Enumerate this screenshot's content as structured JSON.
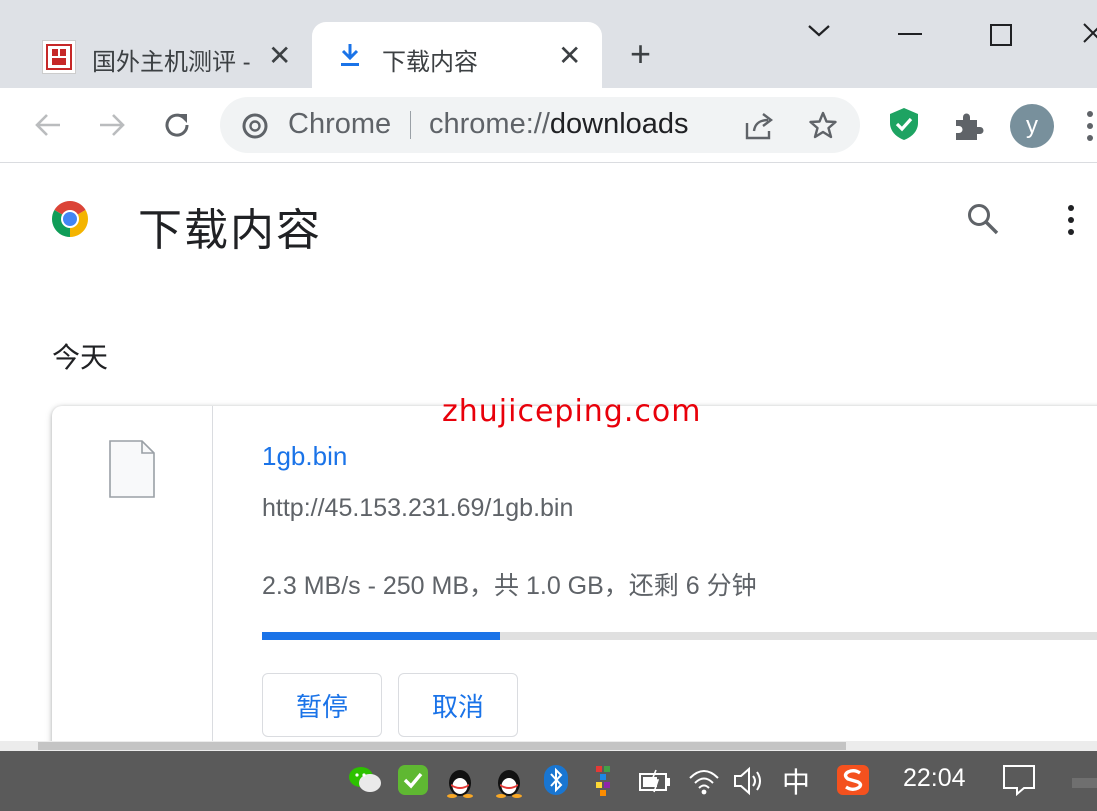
{
  "tabs": [
    {
      "title": "国外主机测评 -",
      "close_glyph": "✕"
    },
    {
      "title": "下载内容",
      "close_glyph": "✕"
    }
  ],
  "tabstrip": {
    "new_tab_glyph": "+"
  },
  "window_controls": {
    "minimize": "—",
    "close": "✕"
  },
  "omnibox": {
    "site_label": "Chrome",
    "url_scheme": "chrome://",
    "url_host": "downloads"
  },
  "profile": {
    "initial": "y"
  },
  "page": {
    "title": "下载内容",
    "section_today": "今天"
  },
  "watermark": "zhujiceping.com",
  "download": {
    "file_name": "1gb.bin",
    "url": "http://45.153.231.69/1gb.bin",
    "status": "2.3 MB/s - 250 MB，共 1.0 GB，还剩 6 分钟",
    "progress": 0.25,
    "pause_label": "暂停",
    "cancel_label": "取消"
  },
  "taskbar": {
    "ime_label": "中",
    "time": "22:04"
  },
  "colors": {
    "accent": "#1a73e8",
    "watermark": "#e8000a",
    "tabstrip": "#dee1e6",
    "taskbar": "#5a5a5a"
  },
  "icons": [
    "download-icon",
    "back-arrow-icon",
    "forward-arrow-icon",
    "reload-icon",
    "chrome-logo-icon",
    "share-icon",
    "star-icon",
    "shield-check-icon",
    "extensions-puzzle-icon",
    "search-icon",
    "more-vert-icon",
    "file-icon",
    "wechat-icon",
    "qq-icon",
    "bluetooth-icon",
    "battery-icon",
    "wifi-icon",
    "volume-icon",
    "sogou-icon",
    "notification-icon"
  ]
}
